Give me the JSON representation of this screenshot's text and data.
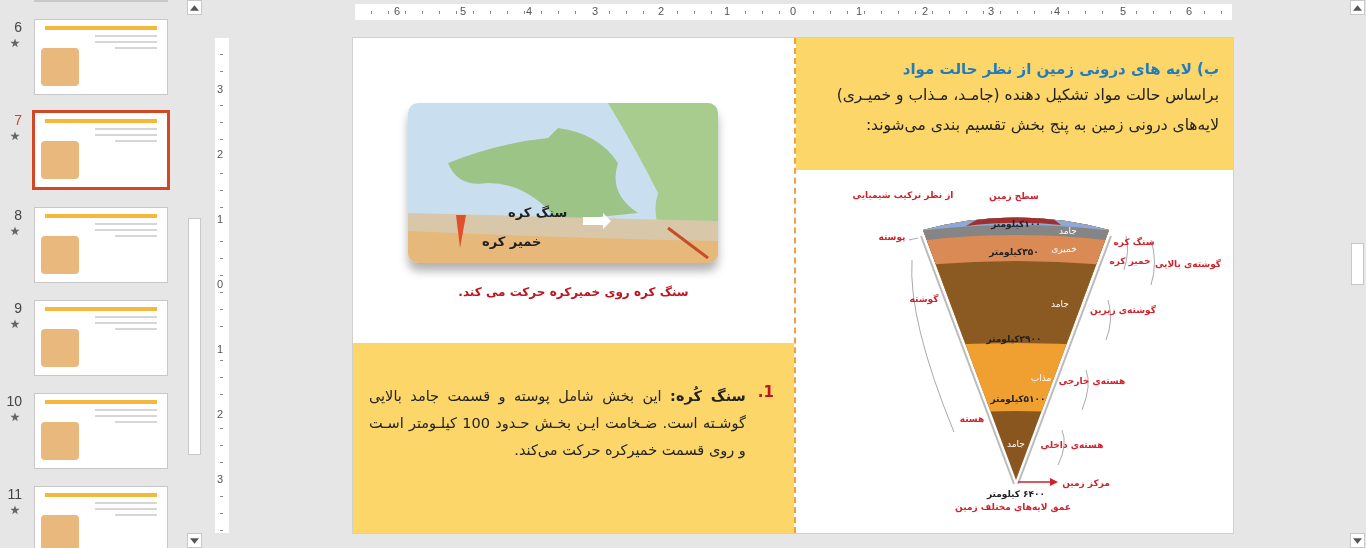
{
  "thumbnails": [
    {
      "number": "6",
      "selected": false
    },
    {
      "number": "7",
      "selected": true
    },
    {
      "number": "8",
      "selected": false
    },
    {
      "number": "9",
      "selected": false
    },
    {
      "number": "10",
      "selected": false
    },
    {
      "number": "11",
      "selected": false
    }
  ],
  "ruler": {
    "horizontal": [
      "6",
      "5",
      "4",
      "3",
      "2",
      "1",
      "0",
      "1",
      "2",
      "3",
      "4",
      "5",
      "6"
    ],
    "vertical": [
      "3",
      "2",
      "1",
      "0",
      "1",
      "2",
      "3"
    ]
  },
  "slide": {
    "heading": "ب) لایه های درونی زمین از نظر حالت مواد",
    "intro": "براساس حالت مواد تشکیل دهنده (جامـد، مـذاب و خمیـری) لایه‌های درونی زمین به پنج بخش تقسیم بندی می‌شوند:",
    "map_labels": [
      "سنگ کره",
      "خمیر کره"
    ],
    "map_caption": "سنگ کره روی خمیرکره حرکت می کند.",
    "list_item": {
      "number": "1.",
      "text": "**سنگ کُره:** این بخش شامل پوسته و قسمت جامد بالایی گوشـته است. ضـخامت ایـن بخـش حـدود 100 کیلـومتر اسـت و روی قسمت خمیرکره حرکت می‌کند."
    },
    "diagram": {
      "subtitle": "از نظر ترکیب شیمیایی",
      "surface": "سطح زمین",
      "depths": [
        "۱۰۰کیلومتر",
        "۳۵۰کیلومتر",
        "۲۹۰۰کیلومتر",
        "۵۱۰۰کیلومتر"
      ],
      "states": [
        "جامد",
        "خمیری",
        "جامد",
        "مذاب",
        "جامد"
      ],
      "left_labels": [
        "پوسته",
        "گوشته",
        "هسته"
      ],
      "right_labels": [
        "سنگ کره",
        "خمیر کره",
        "گوشته‌ی بالایی",
        "گوشته‌ی زیرین",
        "هسته‌ی خارجی",
        "هسته‌ی داخلی"
      ],
      "center": "مرکز زمین",
      "total_depth": "۶۴۰۰ کیلومتر",
      "caption": "عمق لایه‌های مختلف زمین"
    }
  }
}
